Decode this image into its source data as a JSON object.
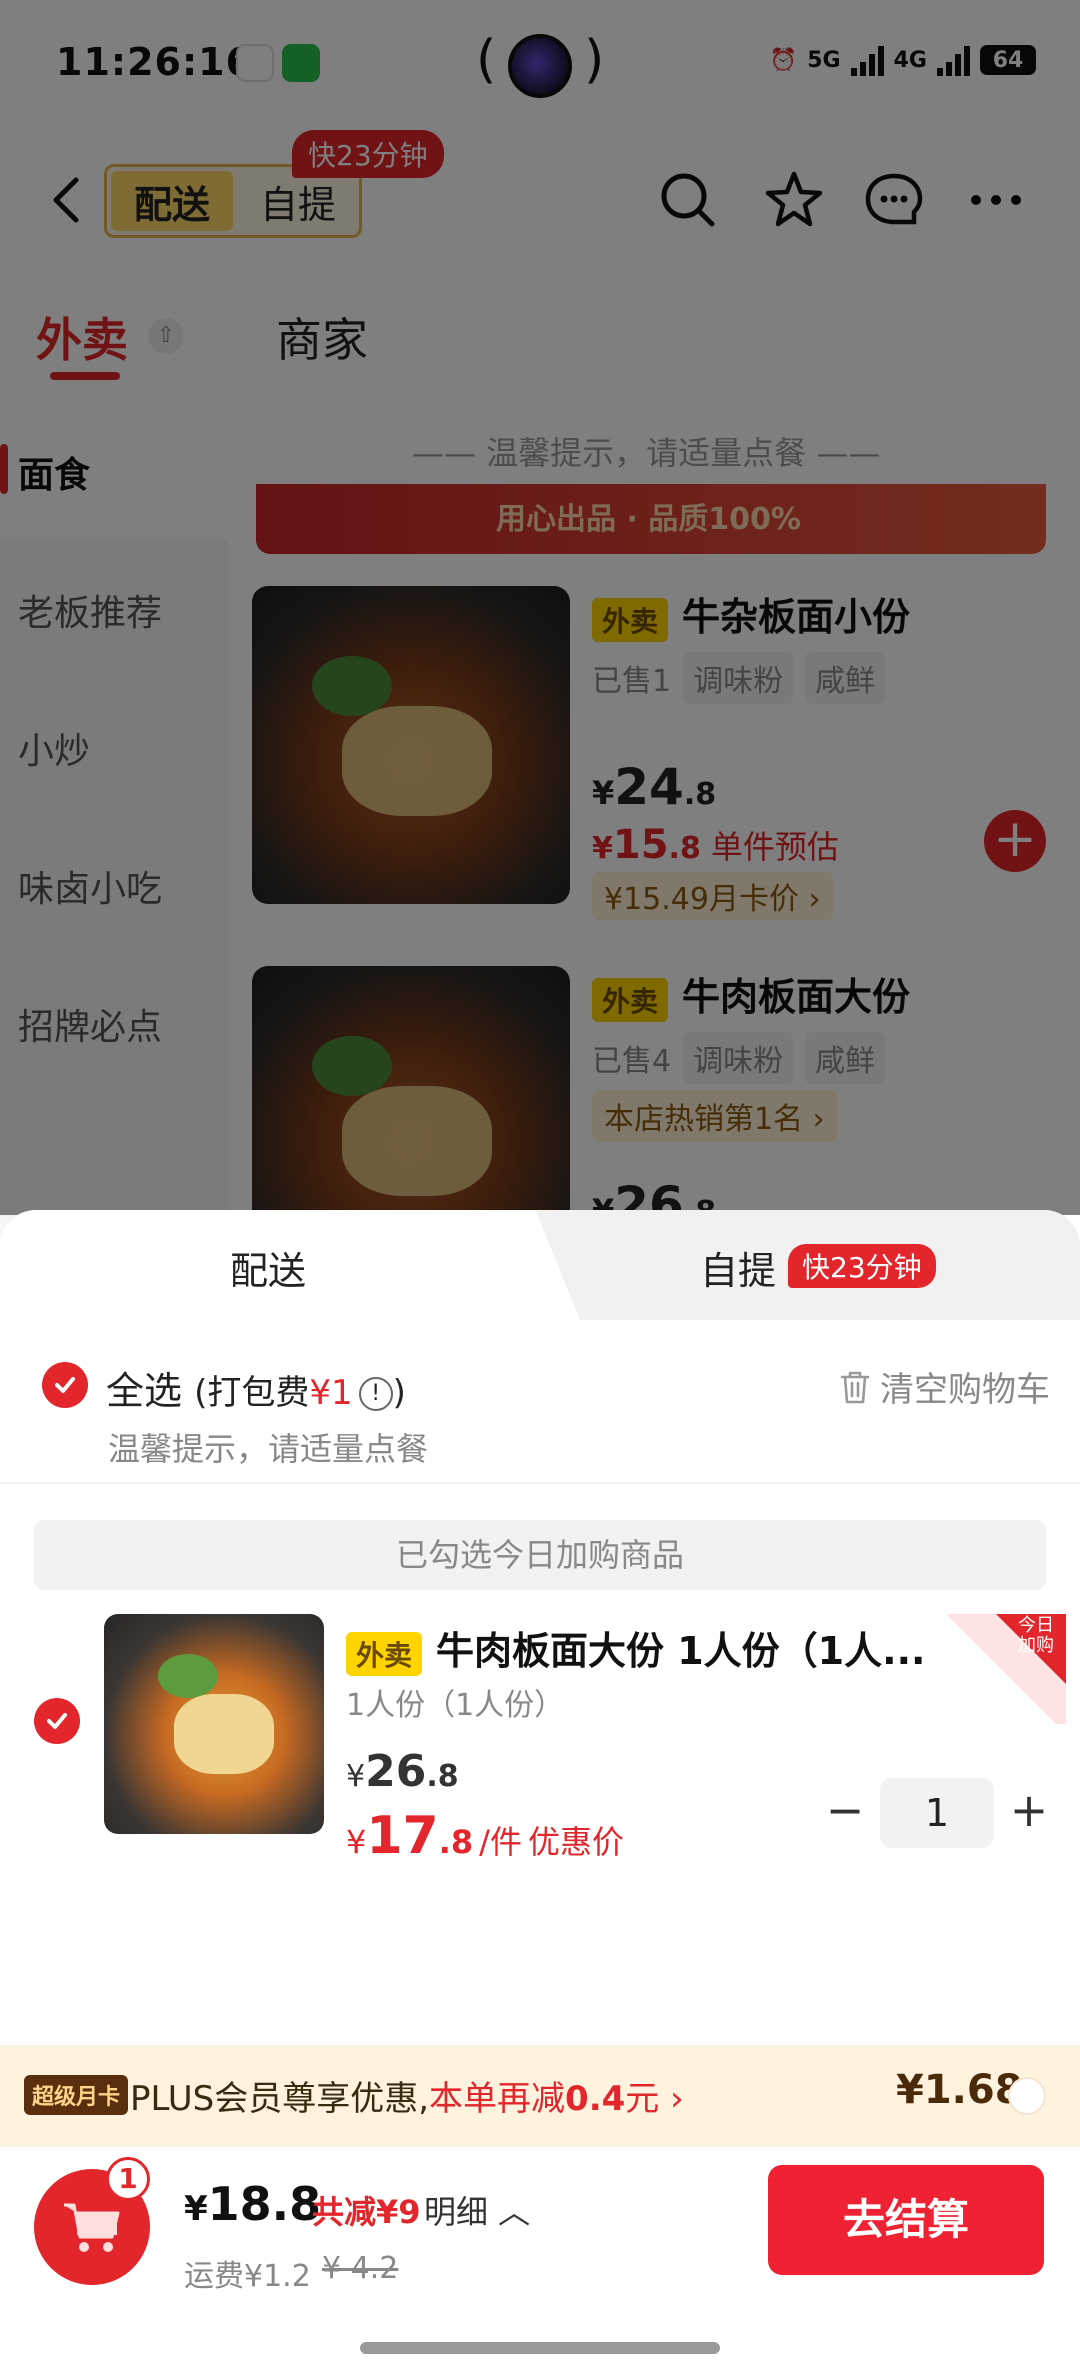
{
  "status_bar": {
    "time": "11:26:16",
    "net1": "5G",
    "net2": "4G",
    "battery": "64"
  },
  "nav": {
    "mode_delivery": "配送",
    "mode_pickup": "自提",
    "fast_badge": "快23分钟"
  },
  "store_tabs": {
    "takeout": "外卖",
    "merchant": "商家"
  },
  "side_nav": {
    "items": [
      "面食",
      "老板推荐",
      "小炒",
      "味卤小吃",
      "招牌必点"
    ]
  },
  "menu": {
    "tip": "—— 温馨提示，请适量点餐 ——",
    "banner_text": "用心出品 · 品质100%",
    "products": [
      {
        "tag": "外卖",
        "title": "牛杂板面小份",
        "chips": [
          "已售1",
          "调味粉",
          "咸鲜"
        ],
        "price_int": "24",
        "price_dec": ".8",
        "est_int": "15",
        "est_dec": ".8",
        "est_label": "单件预估",
        "card_price": "¥15.49月卡价 ›"
      },
      {
        "tag": "外卖",
        "title": "牛肉板面大份",
        "chips": [
          "已售4",
          "调味粉",
          "咸鲜"
        ],
        "rank": "本店热销第1名 ›",
        "price_int": "26",
        "price_dec": ".8"
      }
    ]
  },
  "sheet": {
    "tab_delivery": "配送",
    "tab_pickup": "自提",
    "tab_fast": "快23分钟",
    "select_all": "全选",
    "packing_prefix": "(打包费",
    "packing_fee": "¥1",
    "packing_suffix": ")",
    "select_tip": "温馨提示，请适量点餐",
    "clear_cart": "清空购物车",
    "group_header": "已勾选今日加购商品",
    "item": {
      "tag": "外卖",
      "title": "牛肉板面大份 1人份（1人...",
      "spec": "1人份（1人份）",
      "today_badge": "今日加购",
      "price_int": "26",
      "price_dec": ".8",
      "deal_int": "17",
      "deal_dec": ".8",
      "deal_unit": "/件",
      "deal_label": "优惠价",
      "qty": "1"
    }
  },
  "plus": {
    "badge": "超级月卡",
    "text": "PLUS会员尊享优惠,",
    "text_red": "本单再减",
    "amount": "0.4",
    "text_tail": "元 ›",
    "price": "¥1.68"
  },
  "checkout": {
    "cart_count": "1",
    "total_yen": "¥",
    "total": "18.8",
    "discount": "共减¥9",
    "detail": "明细 ︿",
    "shipping": "运费¥1.2",
    "shipping_old": "¥ 4.2",
    "button": "去结算"
  },
  "colors": {
    "accent": "#e3262b",
    "gold": "#ffd869",
    "plus_bg": "#fff3df"
  }
}
